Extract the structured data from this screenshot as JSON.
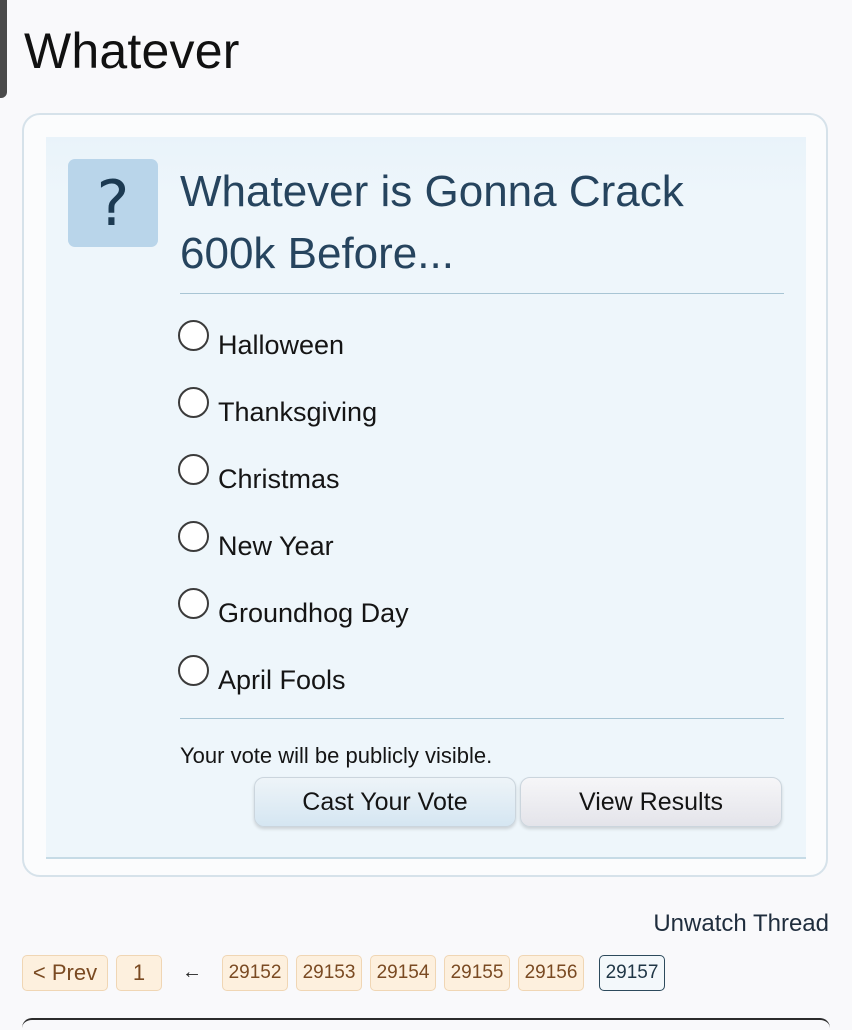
{
  "page": {
    "title": "Whatever"
  },
  "poll": {
    "icon": "question-mark-icon",
    "icon_glyph": "?",
    "question": "Whatever is Gonna Crack 600k Before...",
    "options": [
      {
        "label": "Halloween"
      },
      {
        "label": "Thanksgiving"
      },
      {
        "label": "Christmas"
      },
      {
        "label": "New Year"
      },
      {
        "label": "Groundhog Day"
      },
      {
        "label": "April Fools"
      }
    ],
    "note": "Your vote will be publicly visible.",
    "vote_button": "Cast Your Vote",
    "results_button": "View Results"
  },
  "thread": {
    "unwatch": "Unwatch Thread"
  },
  "pagination": {
    "prev": "< Prev",
    "first": "1",
    "ellipsis_arrow": "←",
    "pages": [
      "29152",
      "29153",
      "29154",
      "29155",
      "29156"
    ],
    "current": "29157"
  },
  "colors": {
    "badge_bg": "#b9d5ea",
    "question_text": "#26445e",
    "page_button_bg": "#fdf0de",
    "current_page_border": "#2d4a5c"
  }
}
